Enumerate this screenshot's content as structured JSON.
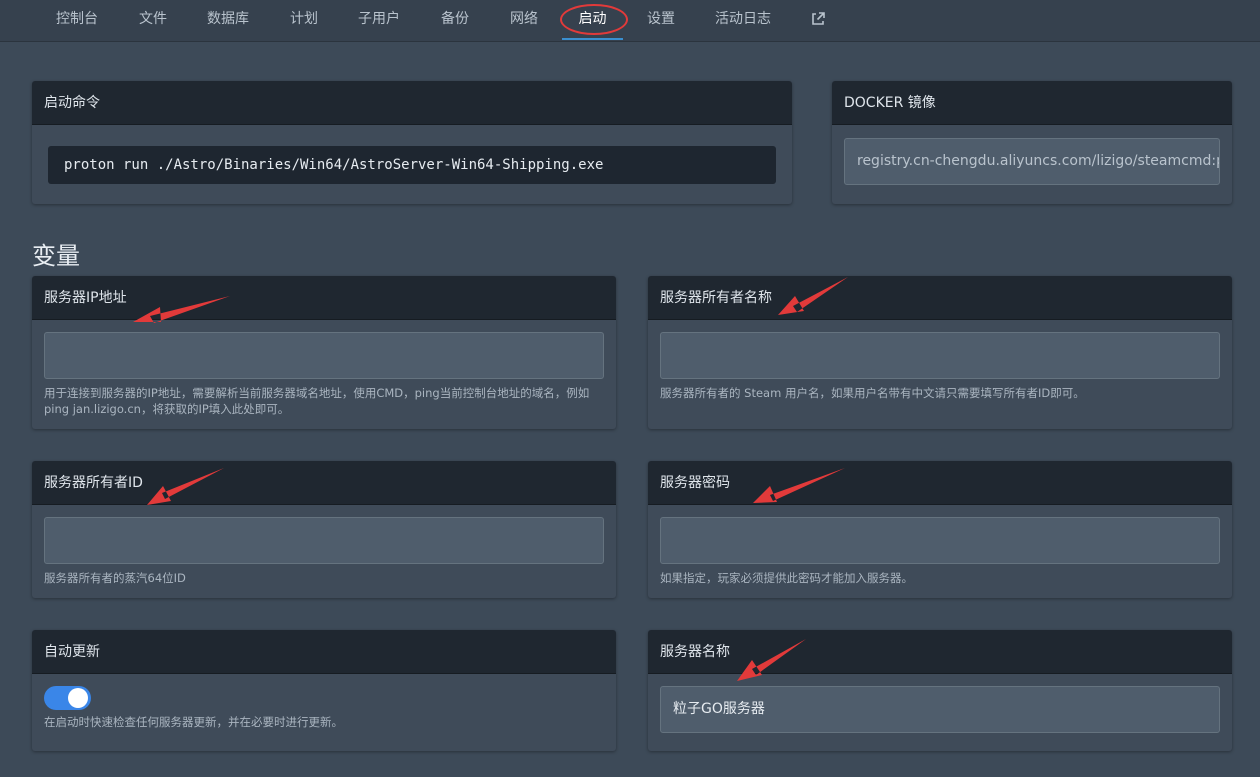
{
  "nav": {
    "items": [
      "控制台",
      "文件",
      "数据库",
      "计划",
      "子用户",
      "备份",
      "网络",
      "启动",
      "设置",
      "活动日志"
    ],
    "active": "启动",
    "external_icon": "external-link-icon"
  },
  "startup": {
    "title": "启动命令",
    "command": "proton run ./Astro/Binaries/Win64/AstroServer-Win64-Shipping.exe"
  },
  "docker": {
    "title": "DOCKER 镜像",
    "image": "registry.cn-chengdu.aliyuncs.com/lizigo/steamcmd:p"
  },
  "variables_title": "变量",
  "variables": {
    "server_ip": {
      "title": "服务器IP地址",
      "value": "",
      "help": "用于连接到服务器的IP地址，需要解析当前服务器域名地址，使用CMD，ping当前控制台地址的域名，例如 ping jan.lizigo.cn，将获取的IP填入此处即可。"
    },
    "owner_name": {
      "title": "服务器所有者名称",
      "value": "",
      "help": "服务器所有者的 Steam 用户名，如果用户名带有中文请只需要填写所有者ID即可。"
    },
    "owner_id": {
      "title": "服务器所有者ID",
      "value": "",
      "help": "服务器所有者的蒸汽64位ID"
    },
    "password": {
      "title": "服务器密码",
      "value": "",
      "help": "如果指定，玩家必须提供此密码才能加入服务器。"
    },
    "auto_update": {
      "title": "自动更新",
      "enabled": true,
      "help": "在启动时快速检查任何服务器更新，并在必要时进行更新。"
    },
    "server_name": {
      "title": "服务器名称",
      "value": "粒子GO服务器"
    }
  },
  "colors": {
    "annotation": "#e23a3a",
    "accent": "#3a86e8"
  }
}
